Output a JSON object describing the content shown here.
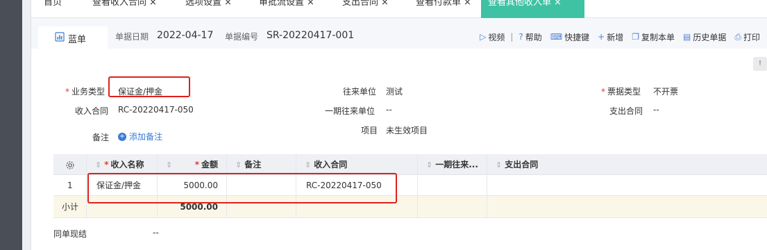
{
  "tabs": [
    {
      "label": "首页",
      "closable": false
    },
    {
      "label": "查看收入合同",
      "closable": true
    },
    {
      "label": "选项设置",
      "closable": true
    },
    {
      "label": "审批流设置",
      "closable": true
    },
    {
      "label": "支出合同",
      "closable": true
    },
    {
      "label": "查看付款单",
      "closable": true
    },
    {
      "label": "查看其他收入单",
      "closable": true,
      "active": true
    }
  ],
  "close_glyph": "×",
  "doc": {
    "tab_label": "蓝单",
    "date_label": "单据日期",
    "date_value": "2022-04-17",
    "number_label": "单据编号",
    "number_value": "SR-20220417-001"
  },
  "toolbar": {
    "video": "视频",
    "help": "帮助",
    "shortcut": "快捷键",
    "add": "新增",
    "copy": "复制本单",
    "history": "历史单据",
    "print": "打印",
    "sep": "|"
  },
  "form": {
    "biz_type_label": "业务类型",
    "biz_type_value": "保证金/押金",
    "partner_label": "往来单位",
    "partner_value": "测试",
    "invoice_type_label": "票据类型",
    "invoice_type_value": "不开票",
    "income_contract_label": "收入合同",
    "income_contract_value": "RC-20220417-050",
    "period_partner_label": "一期往来单位",
    "period_partner_value": "--",
    "expense_contract_label": "支出合同",
    "expense_contract_value": "--",
    "project_label": "项目",
    "project_value": "未生效项目",
    "note_label": "备注",
    "add_note": "添加备注",
    "required_mark": "*"
  },
  "table": {
    "headers": {
      "income_name": "收入名称",
      "amount": "金额",
      "note": "备注",
      "income_contract": "收入合同",
      "period_partner": "一期往来...",
      "expense_contract": "支出合同"
    },
    "rows": [
      {
        "index": "1",
        "income_name": "保证金/押金",
        "amount": "5000.00",
        "note": "",
        "income_contract": "RC-20220417-050",
        "period_partner": "",
        "expense_contract": ""
      }
    ],
    "subtotal_label": "小计",
    "subtotal_amount": "5000.00"
  },
  "footer": {
    "settle_label": "同单现结",
    "settle_value": "--"
  },
  "colors": {
    "active_tab": "#3fc2a4",
    "accent": "#3a7bd5",
    "highlight_box": "#e0201b",
    "subtotal_row": "#fbf7e8"
  }
}
